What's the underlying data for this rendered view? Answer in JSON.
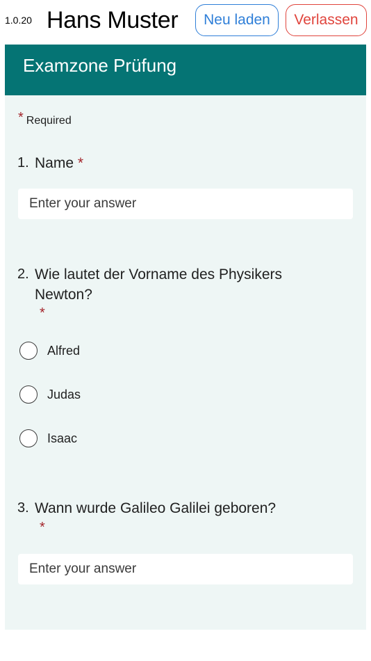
{
  "topbar": {
    "version": "1.0.20",
    "user_name": "Hans Muster",
    "reload_label": "Neu laden",
    "leave_label": "Verlassen"
  },
  "form": {
    "title": "Examzone Prüfung",
    "required_star": "*",
    "required_text": "Required",
    "questions": [
      {
        "number": "1.",
        "text": "Name",
        "required": "*",
        "placeholder": "Enter your answer"
      },
      {
        "number": "2.",
        "text_line1": "Wie lautet der Vorname des Physikers",
        "text_line2": "Newton?",
        "required": "*",
        "options": [
          "Alfred",
          "Judas",
          "Isaac"
        ]
      },
      {
        "number": "3.",
        "text": "Wann wurde Galileo Galilei geboren?",
        "required": "*",
        "placeholder": "Enter your answer"
      }
    ]
  },
  "colors": {
    "header_bg": "#057474",
    "form_bg": "#eef6f5",
    "reload_accent": "#2f7fd8",
    "leave_accent": "#e0443c",
    "required_star": "#a4262c"
  }
}
